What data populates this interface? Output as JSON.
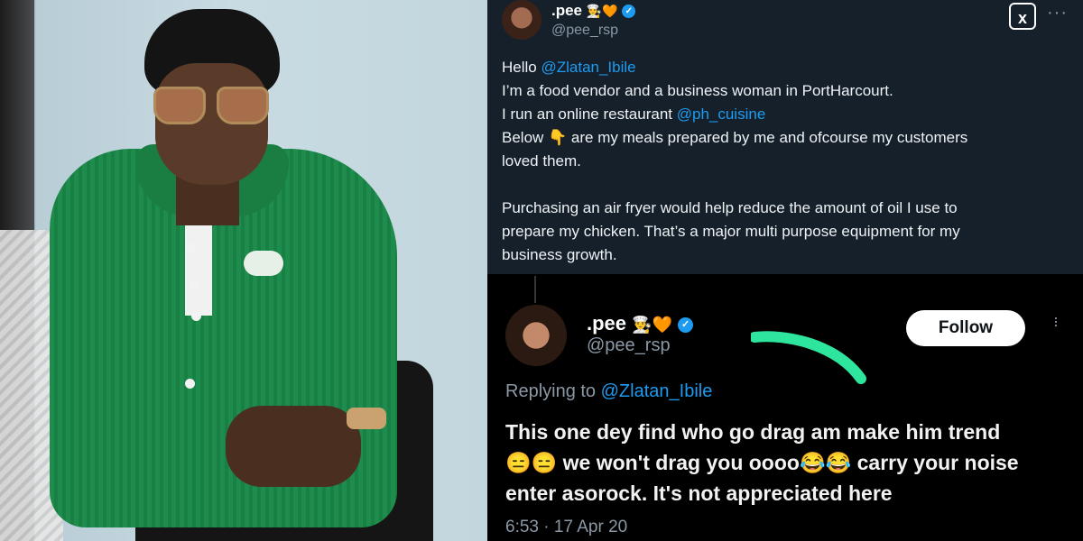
{
  "top_tweet": {
    "name": ".pee",
    "handle": "@pee_rsp",
    "logo_text": "x",
    "paragraphs": {
      "greeting_prefix": "Hello ",
      "greeting_mention": "@Zlatan_Ibile",
      "line2": "I’m a food vendor and a business woman in PortHarcourt.",
      "line3_prefix": "I run an online restaurant ",
      "line3_mention": "@ph_cuisine",
      "line4": "Below 👇 are my meals prepared by me and ofcourse my customers",
      "line5": "loved them.",
      "line6": "Purchasing an air fryer would help reduce the amount of oil I use to",
      "line7": "prepare my chicken. That’s a major multi purpose equipment for my",
      "line8": "business growth."
    },
    "emojis": [
      "👨‍🍳",
      "🧡"
    ]
  },
  "bottom_tweet": {
    "name": ".pee",
    "handle": "@pee_rsp",
    "follow_label": "Follow",
    "replying_prefix": "Replying to ",
    "replying_mention": "@Zlatan_Ibile",
    "lines": [
      "This one dey find who go drag am make him trend",
      "😑😑 we won't drag you oooo😂😂 carry your noise",
      "enter asorock. It's not appreciated here"
    ],
    "timestamp": "6:53 · 17 Apr 20",
    "emojis": [
      "👨‍🍳",
      "🧡"
    ]
  },
  "colors": {
    "top_bg": "#15202b",
    "bottom_bg": "#000000",
    "mention": "#1d9bf0",
    "verified": "#1d9bf0",
    "highlight_stroke": "#2ee59d"
  }
}
